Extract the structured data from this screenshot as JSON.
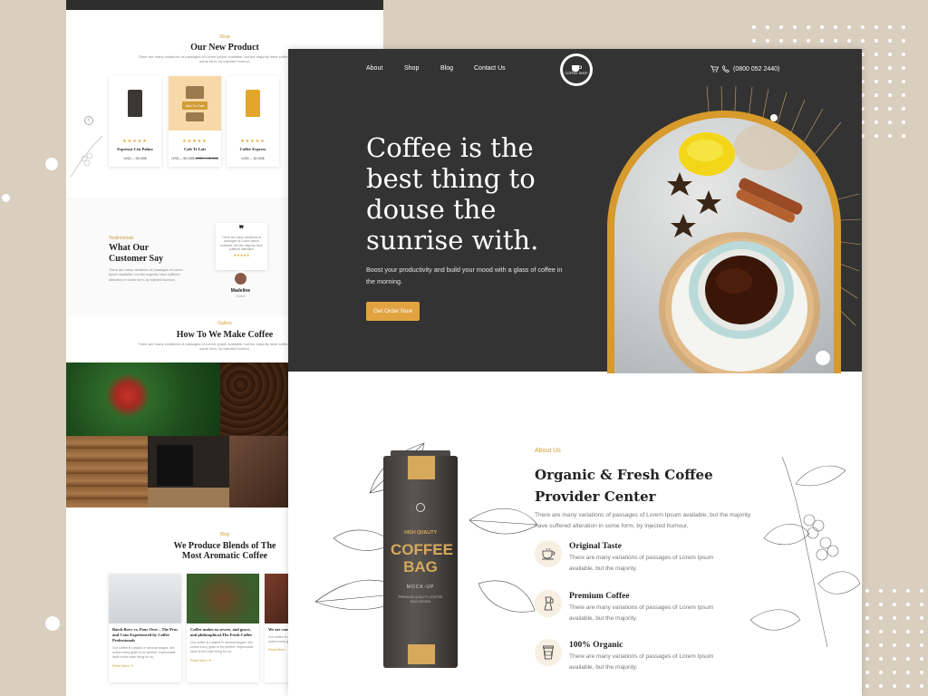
{
  "colors": {
    "background": "#d9cfbf",
    "hero_bg": "#333333",
    "accent": "#e0a33f",
    "gold": "#d79a2c"
  },
  "back_page": {
    "products_section": {
      "kicker": "Shop",
      "title": "Our New Product",
      "subtitle": "There are many variations of passages of Lorem Ipsum available, but the majority have suffered alteration in some form, by injected humour,",
      "products": [
        {
          "name": "Espresso-Cen Palmo",
          "price": "USD – 35.00$",
          "rating": "★★★★★",
          "icon": "coffee-bag-dark-icon"
        },
        {
          "name": "Cafe Te Latt",
          "price": "USD – 50.00$",
          "old_price": "USD – 45.00$",
          "rating": "★★★★★",
          "badge": "Add To Cart",
          "icon": "coffee-bag-kraft-icon"
        },
        {
          "name": "Coffee Express",
          "price": "USD – 30.00$",
          "rating": "★★★★★",
          "icon": "coffee-bag-yellow-icon"
        }
      ]
    },
    "testimonials": {
      "kicker": "Testimonials",
      "title_line1": "What Our",
      "title_line2": "Customer Say",
      "text": "There are many variations of passages of Lorem Ipsum available, but the majority have suffered alteration in some form, by injected humour,",
      "quote": "There are many variations of passages of Lorem Ipsum available, but the majority have suffered alteration",
      "stars": "★★★★★",
      "name": "Madeline",
      "role": "Client"
    },
    "process": {
      "kicker": "Gallery",
      "title": "How To We Make Coffee",
      "subtitle": "There are many variations of passages of Lorem Ipsum available, but the majority have suffered alteration in some form, by injected humour,"
    },
    "blog": {
      "kicker": "Blog",
      "title_line1": "We Produce Blends of The",
      "title_line2": "Most Aromatic Coffee",
      "posts": [
        {
          "title": "Batch Brew vs. Pour Over – The Pros and Cons Experienced by Coffee Professionals",
          "desc": "Our coffee is roasted in several stages. We select every grain to be perfect. Impeccable taste is the main thing for us.",
          "more": "Read More ➜"
        },
        {
          "title": "Coffee makes us severe, and grave, and philosophical.The Fresh Coffee",
          "desc": "Our coffee is roasted in several stages. We select every grain to be perfect. Impeccable taste is the main thing for us.",
          "more": "Read More ➜"
        },
        {
          "title": "We are com quality beans knowing b",
          "desc": "Our coffee is roasted in several stages. We select every grain",
          "more": "Read More"
        }
      ]
    }
  },
  "front_page": {
    "nav": {
      "about": "About",
      "shop": "Shop",
      "blog": "Blog",
      "contact": "Contact Us"
    },
    "logo_text": "COFFEE SHOP",
    "phone": "(0800 052 2440)",
    "hero": {
      "title": "Coffee is the best thing to douse the sunrise with.",
      "subtitle": "Boost your productivity and build your mood with a glass of coffee in the morning.",
      "cta": "Get Order Now"
    },
    "about": {
      "kicker": "About Us",
      "title": "Organic & Fresh Coffee Provider Center",
      "desc": "There are many variations of passages of Lorem Ipsum available, but the majority have suffered alteration in some form, by injected humour,",
      "features": [
        {
          "title": "Original Taste",
          "desc": "There are many variations of passages of Lorem Ipsum available, but the majority.",
          "icon": "coffee-cup-icon"
        },
        {
          "title": "Premium Coffee",
          "desc": "There are many variations of passages of Lorem Ipsum available, but the majority.",
          "icon": "moka-pot-icon"
        },
        {
          "title": "100% Organic",
          "desc": "There are many variations of passages of Lorem Ipsum available, but the majority.",
          "icon": "takeaway-cup-icon"
        }
      ]
    },
    "bag": {
      "label_top": "HIGH QUALITY",
      "label_main": "COFFEE BAG",
      "label_sub": "MOCK-UP",
      "label_small": "PREMIUM QUALITY COFFEE BAG DESIGN"
    }
  }
}
